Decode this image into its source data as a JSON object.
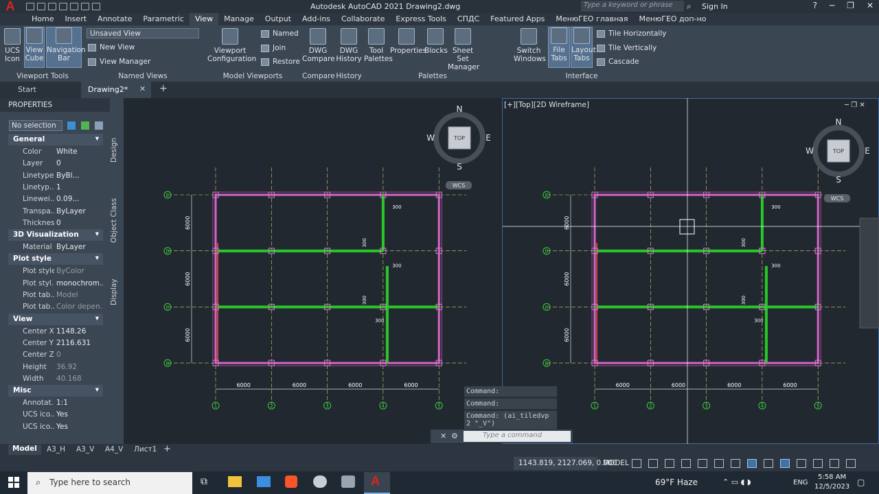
{
  "app": {
    "title": "Autodesk AutoCAD 2021    Drawing2.dwg",
    "search_placeholder": "Type a keyword or phrase",
    "sign_in": "Sign In"
  },
  "menu_tabs": [
    "Home",
    "Insert",
    "Annotate",
    "Parametric",
    "View",
    "Manage",
    "Output",
    "Add-ins",
    "Collaborate",
    "Express Tools",
    "СПДС",
    "Featured Apps",
    "МенюГЕО главная",
    "МенюГЕО доп-но"
  ],
  "ribbon": {
    "viewport_tools": {
      "title": "Viewport Tools",
      "ucs": "UCS Icon",
      "viewcube": "View Cube",
      "navbar": "Navigation Bar"
    },
    "named_views": {
      "title": "Named Views",
      "dropdown": "Unsaved View",
      "new": "New View",
      "manager": "View Manager"
    },
    "model_viewports": {
      "title": "Model Viewports",
      "config": "Viewport Configuration",
      "named": "Named",
      "join": "Join",
      "restore": "Restore"
    },
    "compare": {
      "title": "Compare",
      "label": "DWG Compare"
    },
    "history": {
      "title": "History",
      "label": "DWG History"
    },
    "palettes": {
      "title": "Palettes",
      "tool": "Tool Palettes",
      "properties": "Properties",
      "blocks": "Blocks",
      "sheetset": "Sheet Set Manager"
    },
    "interface": {
      "title": "Interface",
      "switch": "Switch Windows",
      "filetabs": "File Tabs",
      "layouttabs": "Layout Tabs",
      "tile_h": "Tile Horizontally",
      "tile_v": "Tile Vertically",
      "cascade": "Cascade"
    }
  },
  "doc_tabs": {
    "start": "Start",
    "drawing": "Drawing2*"
  },
  "properties": {
    "header": "PROPERTIES",
    "selection": "No selection",
    "side_tabs": [
      "Design",
      "Object Class",
      "Display"
    ],
    "sections": [
      {
        "name": "General",
        "rows": [
          [
            "Color",
            "White"
          ],
          [
            "Layer",
            "0"
          ],
          [
            "Linetype",
            "ByBl..."
          ],
          [
            "Linetyp...",
            "1"
          ],
          [
            "Linewei...",
            "0.09..."
          ],
          [
            "Transpa...",
            "ByLayer"
          ],
          [
            "Thickness",
            "0"
          ]
        ]
      },
      {
        "name": "3D Visualization",
        "rows": [
          [
            "Material",
            "ByLayer"
          ]
        ]
      },
      {
        "name": "Plot style",
        "rows": [
          [
            "Plot style",
            "ByColor"
          ],
          [
            "Plot styl...",
            "monochrom..."
          ],
          [
            "Plot tab...",
            "Model"
          ],
          [
            "Plot tab...",
            "Color depen..."
          ]
        ]
      },
      {
        "name": "View",
        "rows": [
          [
            "Center X",
            "1148.26"
          ],
          [
            "Center Y",
            "2116.631"
          ],
          [
            "Center Z",
            "0"
          ],
          [
            "Height",
            "36.92"
          ],
          [
            "Width",
            "40.168"
          ]
        ]
      },
      {
        "name": "Misc",
        "rows": [
          [
            "Annotat...",
            "1:1"
          ],
          [
            "UCS ico...",
            "Yes"
          ],
          [
            "UCS ico...",
            "Yes"
          ]
        ]
      }
    ]
  },
  "viewport": {
    "label": "[+][Top][2D Wireframe]",
    "wcs": "WCS",
    "cube_top": "TOP",
    "compass": [
      "N",
      "S",
      "W",
      "E"
    ]
  },
  "drawing": {
    "dims_h": [
      "6000",
      "6000",
      "6000",
      "6000"
    ],
    "dims_v": [
      "6000",
      "6000",
      "6000"
    ],
    "wall_dims": [
      "300",
      "300",
      "300",
      "300",
      "300"
    ],
    "axes_x": [
      "1",
      "2",
      "3",
      "4",
      "5"
    ],
    "axes_y": [
      "E",
      "D",
      "C",
      "B"
    ]
  },
  "command": {
    "history": [
      "Command:",
      "Command:",
      "Command: (ai_tiledvp 2 \"_V\")"
    ],
    "placeholder": "Type a command"
  },
  "layout_tabs": [
    "Model",
    "A3_H",
    "A3_V",
    "A4_V",
    "Лист1"
  ],
  "status": {
    "coords": "1143.819, 2127.069, 0.000",
    "mode": "MODEL"
  },
  "taskbar": {
    "search": "Type here to search",
    "weather": "69°F  Haze",
    "lang": "ENG",
    "time": "5:58 AM",
    "date": "12/5/2023"
  }
}
